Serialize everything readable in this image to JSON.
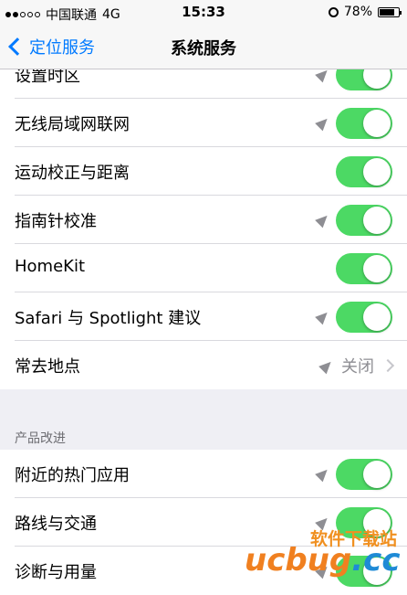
{
  "status_bar": {
    "carrier": "中国联通",
    "network": "4G",
    "time": "15:33",
    "battery": "78%",
    "battery_level": 0.78,
    "signal_bars": 2
  },
  "nav": {
    "back_label": "定位服务",
    "title": "系统服务"
  },
  "group1": [
    {
      "label": "设置时区",
      "location_arrow": true,
      "toggle": "on"
    },
    {
      "label": "无线局域网联网",
      "location_arrow": true,
      "toggle": "on"
    },
    {
      "label": "运动校正与距离",
      "location_arrow": false,
      "toggle": "on"
    },
    {
      "label": "指南针校准",
      "location_arrow": true,
      "toggle": "on"
    },
    {
      "label": "HomeKit",
      "location_arrow": false,
      "toggle": "on"
    },
    {
      "label": "Safari 与 Spotlight 建议",
      "location_arrow": true,
      "toggle": "on"
    },
    {
      "label": "常去地点",
      "location_arrow": true,
      "value": "关闭"
    }
  ],
  "section2_header": "产品改进",
  "group2": [
    {
      "label": "附近的热门应用",
      "location_arrow": true,
      "toggle": "on"
    },
    {
      "label": "路线与交通",
      "location_arrow": true,
      "toggle": "on"
    },
    {
      "label": "诊断与用量",
      "location_arrow": true,
      "toggle": "on"
    }
  ],
  "watermark": {
    "top_text": "软件下载站",
    "logo_main": "ucbug",
    "logo_suffix": ".cc"
  },
  "colors": {
    "toggle_on": "#4cd964",
    "accent": "#007aff",
    "background": "#efeff4"
  }
}
